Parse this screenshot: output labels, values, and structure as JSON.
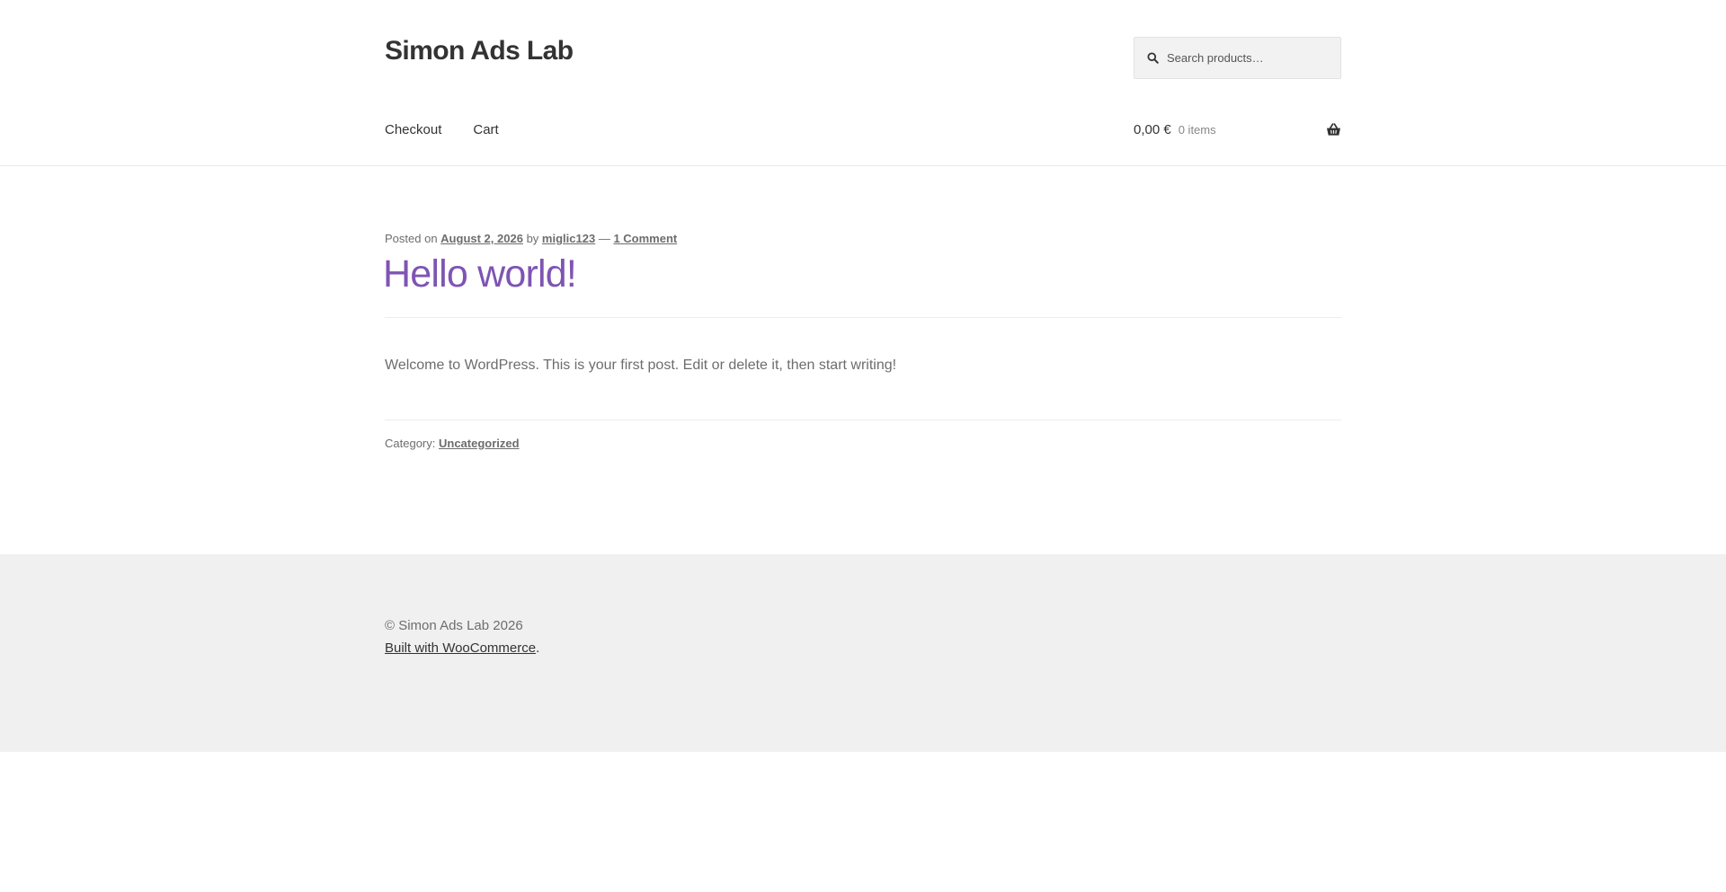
{
  "header": {
    "site_title": "Simon Ads Lab",
    "search": {
      "placeholder": "Search products…",
      "value": ""
    },
    "nav": [
      {
        "label": "Checkout"
      },
      {
        "label": "Cart"
      }
    ],
    "cart": {
      "amount": "0,00 €",
      "count": "0 items"
    }
  },
  "post": {
    "meta": {
      "posted_on_prefix": "Posted on",
      "date": "August 2, 2026",
      "by_text": "by",
      "author": "miglic123",
      "separator": "—",
      "comments": "1 Comment"
    },
    "title": "Hello world!",
    "content": "Welcome to WordPress. This is your first post. Edit or delete it, then start writing!",
    "category_label": "Category:",
    "category": "Uncategorized"
  },
  "footer": {
    "copyright": "© Simon Ads Lab 2026",
    "credit_link": "Built with WooCommerce",
    "credit_suffix": "."
  },
  "colors": {
    "accent": "#7f54b3",
    "text": "#6d6d6d",
    "heading": "#333333",
    "footer_bg": "#f0f0f0"
  }
}
